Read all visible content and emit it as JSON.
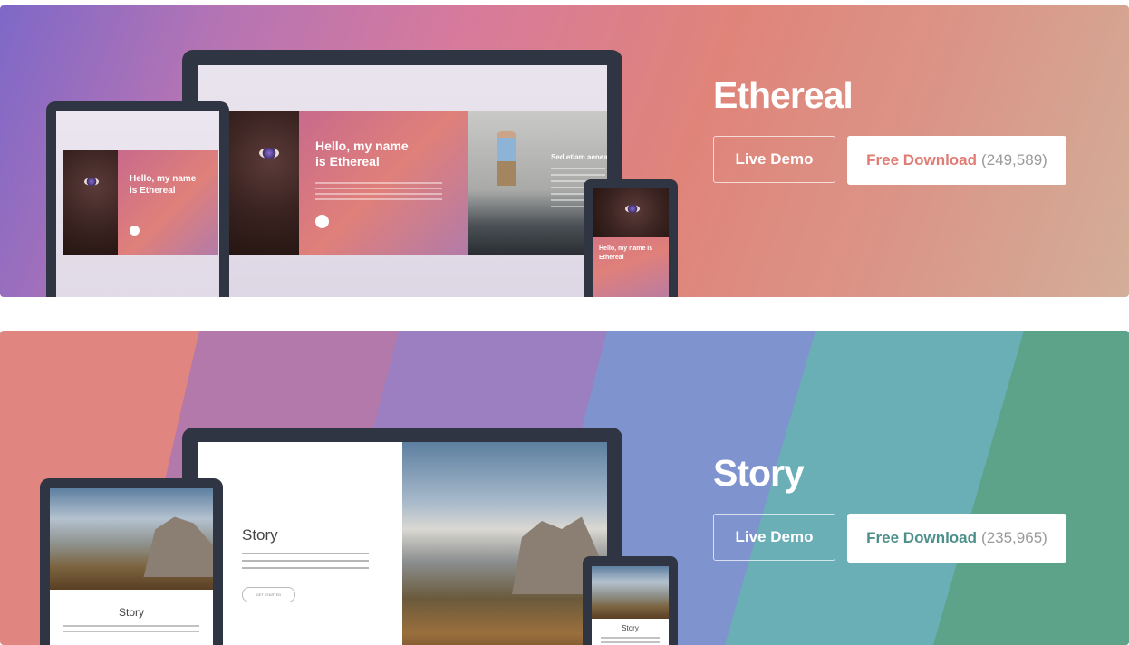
{
  "themes": [
    {
      "title": "Ethereal",
      "live_demo_label": "Live Demo",
      "download_label": "Free Download",
      "download_count": "(249,589)",
      "preview": {
        "headline_line1": "Hello, my name",
        "headline_line2": "is Ethereal",
        "side_heading": "Sed etiam aenea",
        "phone_headline_line1": "Hello, my name is",
        "phone_headline_line2": "Ethereal"
      }
    },
    {
      "title": "Story",
      "live_demo_label": "Live Demo",
      "download_label": "Free Download",
      "download_count": "(235,965)",
      "preview": {
        "heading": "Story",
        "get_started": "GET STARTED",
        "tablet_heading": "Story",
        "phone_heading": "Story"
      }
    }
  ],
  "colors": {
    "ethereal_gradient": [
      "#7e68c8",
      "#d77a9c",
      "#e0847a",
      "#d3ae98"
    ],
    "story_stripes": [
      "#e0857f",
      "#b479ab",
      "#9b7fc0",
      "#7f93cf",
      "#6aaeb6",
      "#5da38a"
    ]
  }
}
